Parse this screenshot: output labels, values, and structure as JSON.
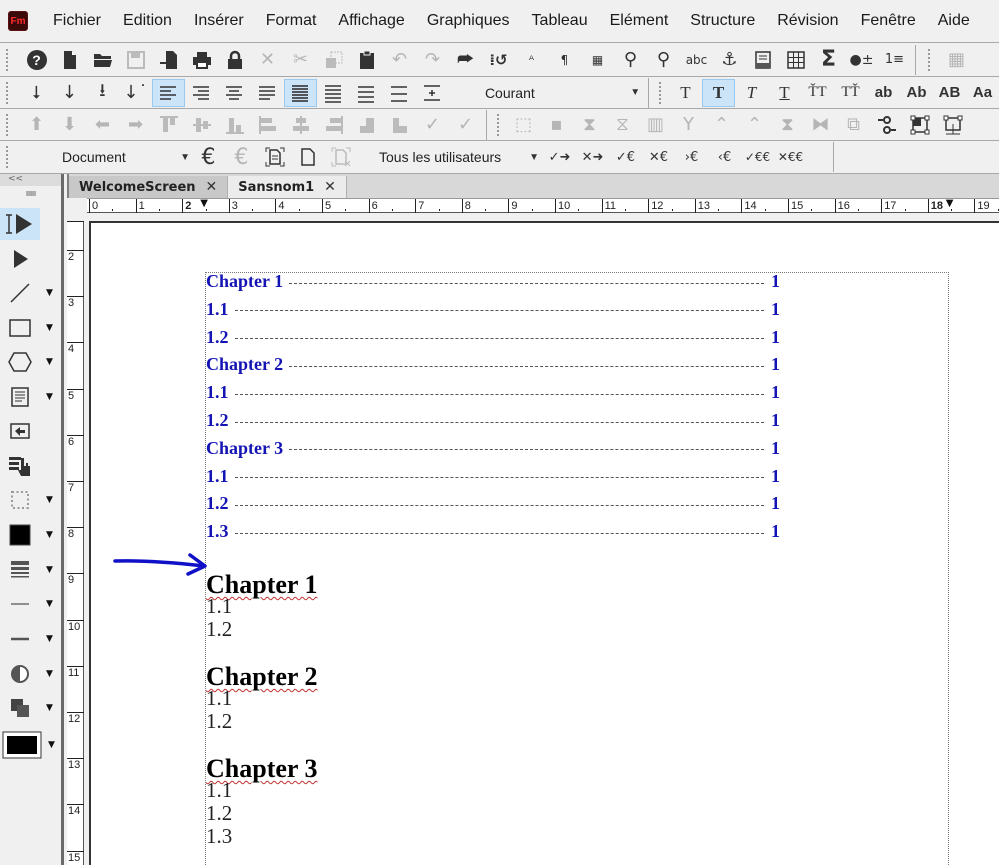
{
  "app": {
    "logo": "Fm",
    "menu": [
      "Fichier",
      "Edition",
      "Insérer",
      "Format",
      "Affichage",
      "Graphiques",
      "Tableau",
      "Elément",
      "Structure",
      "Révision",
      "Fenêtre",
      "Aide"
    ]
  },
  "toolbar2": {
    "paragraph_style": "Courant",
    "char_buttons": [
      "T",
      "T",
      "T",
      "T",
      "ŤT",
      "TŤ",
      "ab",
      "Ab",
      "AB",
      "Aa"
    ]
  },
  "toolbar4": {
    "view_mode": "Document",
    "users_filter": "Tous les utilisateurs"
  },
  "palette": {
    "collapse": "<<",
    "grip": "IIIIIIIII"
  },
  "tabs": [
    {
      "label": "WelcomeScreen",
      "active": false
    },
    {
      "label": "Sansnom1",
      "active": true
    }
  ],
  "ruler": {
    "h_labels": [
      "0",
      "1",
      "2",
      "3",
      "4",
      "5",
      "6",
      "7",
      "8",
      "9",
      "10",
      "11",
      "12",
      "13",
      "14",
      "15",
      "16",
      "17",
      "18",
      "19"
    ],
    "v_labels": [
      "2",
      "3",
      "4",
      "5",
      "6",
      "7",
      "8",
      "9",
      "10",
      "11",
      "12",
      "13",
      "14",
      "15"
    ]
  },
  "document": {
    "toc": [
      {
        "label": "Chapter 1",
        "page": "1"
      },
      {
        "label": "1.1",
        "page": "1"
      },
      {
        "label": "1.2",
        "page": "1"
      },
      {
        "label": "Chapter 2",
        "page": "1"
      },
      {
        "label": "1.1",
        "page": "1"
      },
      {
        "label": "1.2",
        "page": "1"
      },
      {
        "label": "Chapter 3",
        "page": "1"
      },
      {
        "label": "1.1",
        "page": "1"
      },
      {
        "label": "1.2",
        "page": "1"
      },
      {
        "label": "1.3",
        "page": "1"
      }
    ],
    "chapters": [
      {
        "title": "Chapter 1",
        "sections": [
          "1.1",
          "1.2"
        ]
      },
      {
        "title": "Chapter 2",
        "sections": [
          "1.1",
          "1.2"
        ]
      },
      {
        "title": "Chapter 3",
        "sections": [
          "1.1",
          "1.2",
          "1.3"
        ]
      }
    ],
    "toc_color": "#1414b4",
    "annotation_arrow_color": "#1010c8"
  }
}
